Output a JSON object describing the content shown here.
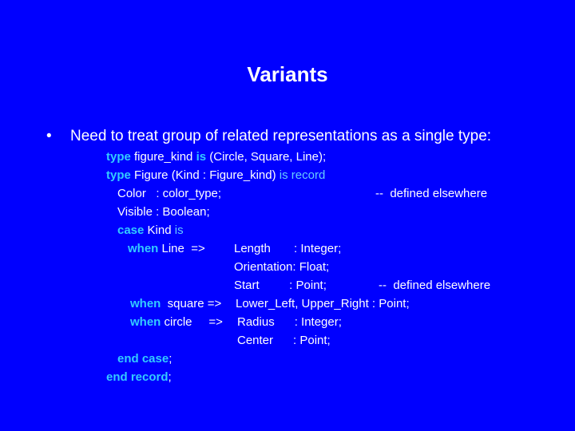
{
  "slide": {
    "title": "Variants",
    "bullet": {
      "symbol": "•",
      "text": "Need to treat group of related representations as a single type:"
    },
    "code": {
      "line1": {
        "kw1": "type",
        "t1": " figure_kind ",
        "kw2": "is",
        "t2": " (Circle, Square, Line);"
      },
      "line2": {
        "kw1": "type",
        "t1": " Figure (Kind : Figure_kind) ",
        "kw2": "is record"
      },
      "line3": {
        "field": "Color   : color_type;",
        "comment": "--  defined elsewhere"
      },
      "line4": {
        "field": "Visible : Boolean;"
      },
      "line5": {
        "kw1": "case",
        "t1": " Kind ",
        "kw2": "is"
      },
      "line6": {
        "kw1": "when",
        "t1": " Line  =>",
        "decl": "Length       : Integer;"
      },
      "line7": {
        "decl": "Orientation: Float;"
      },
      "line8": {
        "decl": "Start         : Point;",
        "comment": "--  defined elsewhere"
      },
      "line9": {
        "kw1": "when",
        "t1": "  square =>",
        "decl": "Lower_Left, Upper_Right : Point;"
      },
      "line10": {
        "kw1": "when",
        "t1": " circle     =>",
        "decl": "Radius      : Integer;"
      },
      "line11": {
        "decl": "Center      : Point;"
      },
      "line12": {
        "kw1": "end case",
        "t1": ";"
      },
      "line13": {
        "kw1": "end record",
        "t1": ";"
      }
    },
    "colors": {
      "background": "#0000FF",
      "text": "#FFFFFF",
      "keyword": "#33CCFF",
      "keyword_light": "#66CCFF"
    }
  }
}
